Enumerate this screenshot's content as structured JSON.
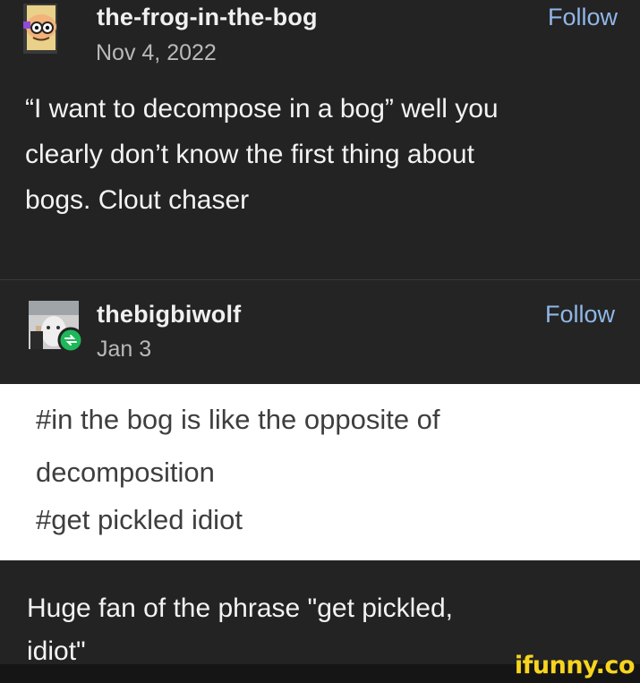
{
  "posts": [
    {
      "username": "the-frog-in-the-bog",
      "date": "Nov 4, 2022",
      "follow_label": "Follow",
      "avatar_icon": "frog-face-icon",
      "body_lines": [
        "“I want to decompose in a bog” well you",
        "clearly don’t know the first thing about",
        "bogs. Clout chaser"
      ]
    },
    {
      "username": "thebigbiwolf",
      "date": "Jan 3",
      "follow_label": "Follow",
      "avatar_icon": "wolf-photo-icon",
      "badge_icon": "reblog-badge-icon",
      "tags": [
        "#in the bog is like the opposite of",
        "decomposition",
        "#get pickled idiot"
      ]
    },
    {
      "body_lines": [
        "Huge fan of the phrase \"get pickled,",
        "idiot\""
      ]
    }
  ],
  "watermark": "ifunny.co",
  "colors": {
    "background": "#232323",
    "follow_link": "#8fb7e8",
    "tag_area": "#ffffff",
    "watermark": "#f7d41f"
  }
}
